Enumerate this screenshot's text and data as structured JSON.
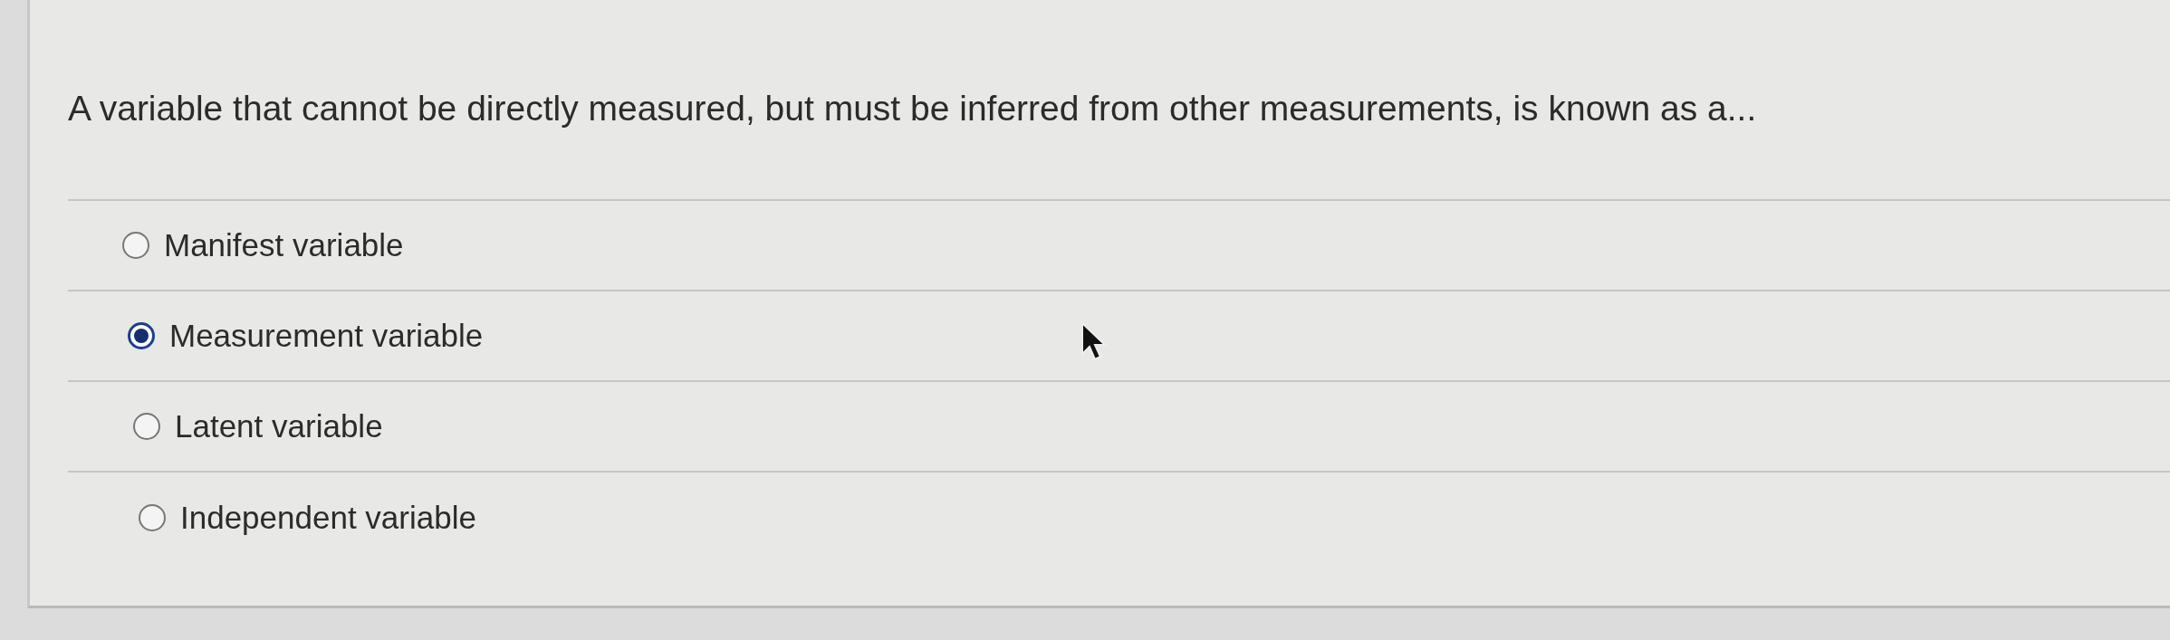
{
  "question": {
    "text": "A variable that cannot be directly measured, but must be inferred from other measurements, is known as a...",
    "options": [
      {
        "label": "Manifest variable",
        "selected": false
      },
      {
        "label": "Measurement variable",
        "selected": true
      },
      {
        "label": "Latent variable",
        "selected": false
      },
      {
        "label": "Independent variable",
        "selected": false
      }
    ]
  }
}
